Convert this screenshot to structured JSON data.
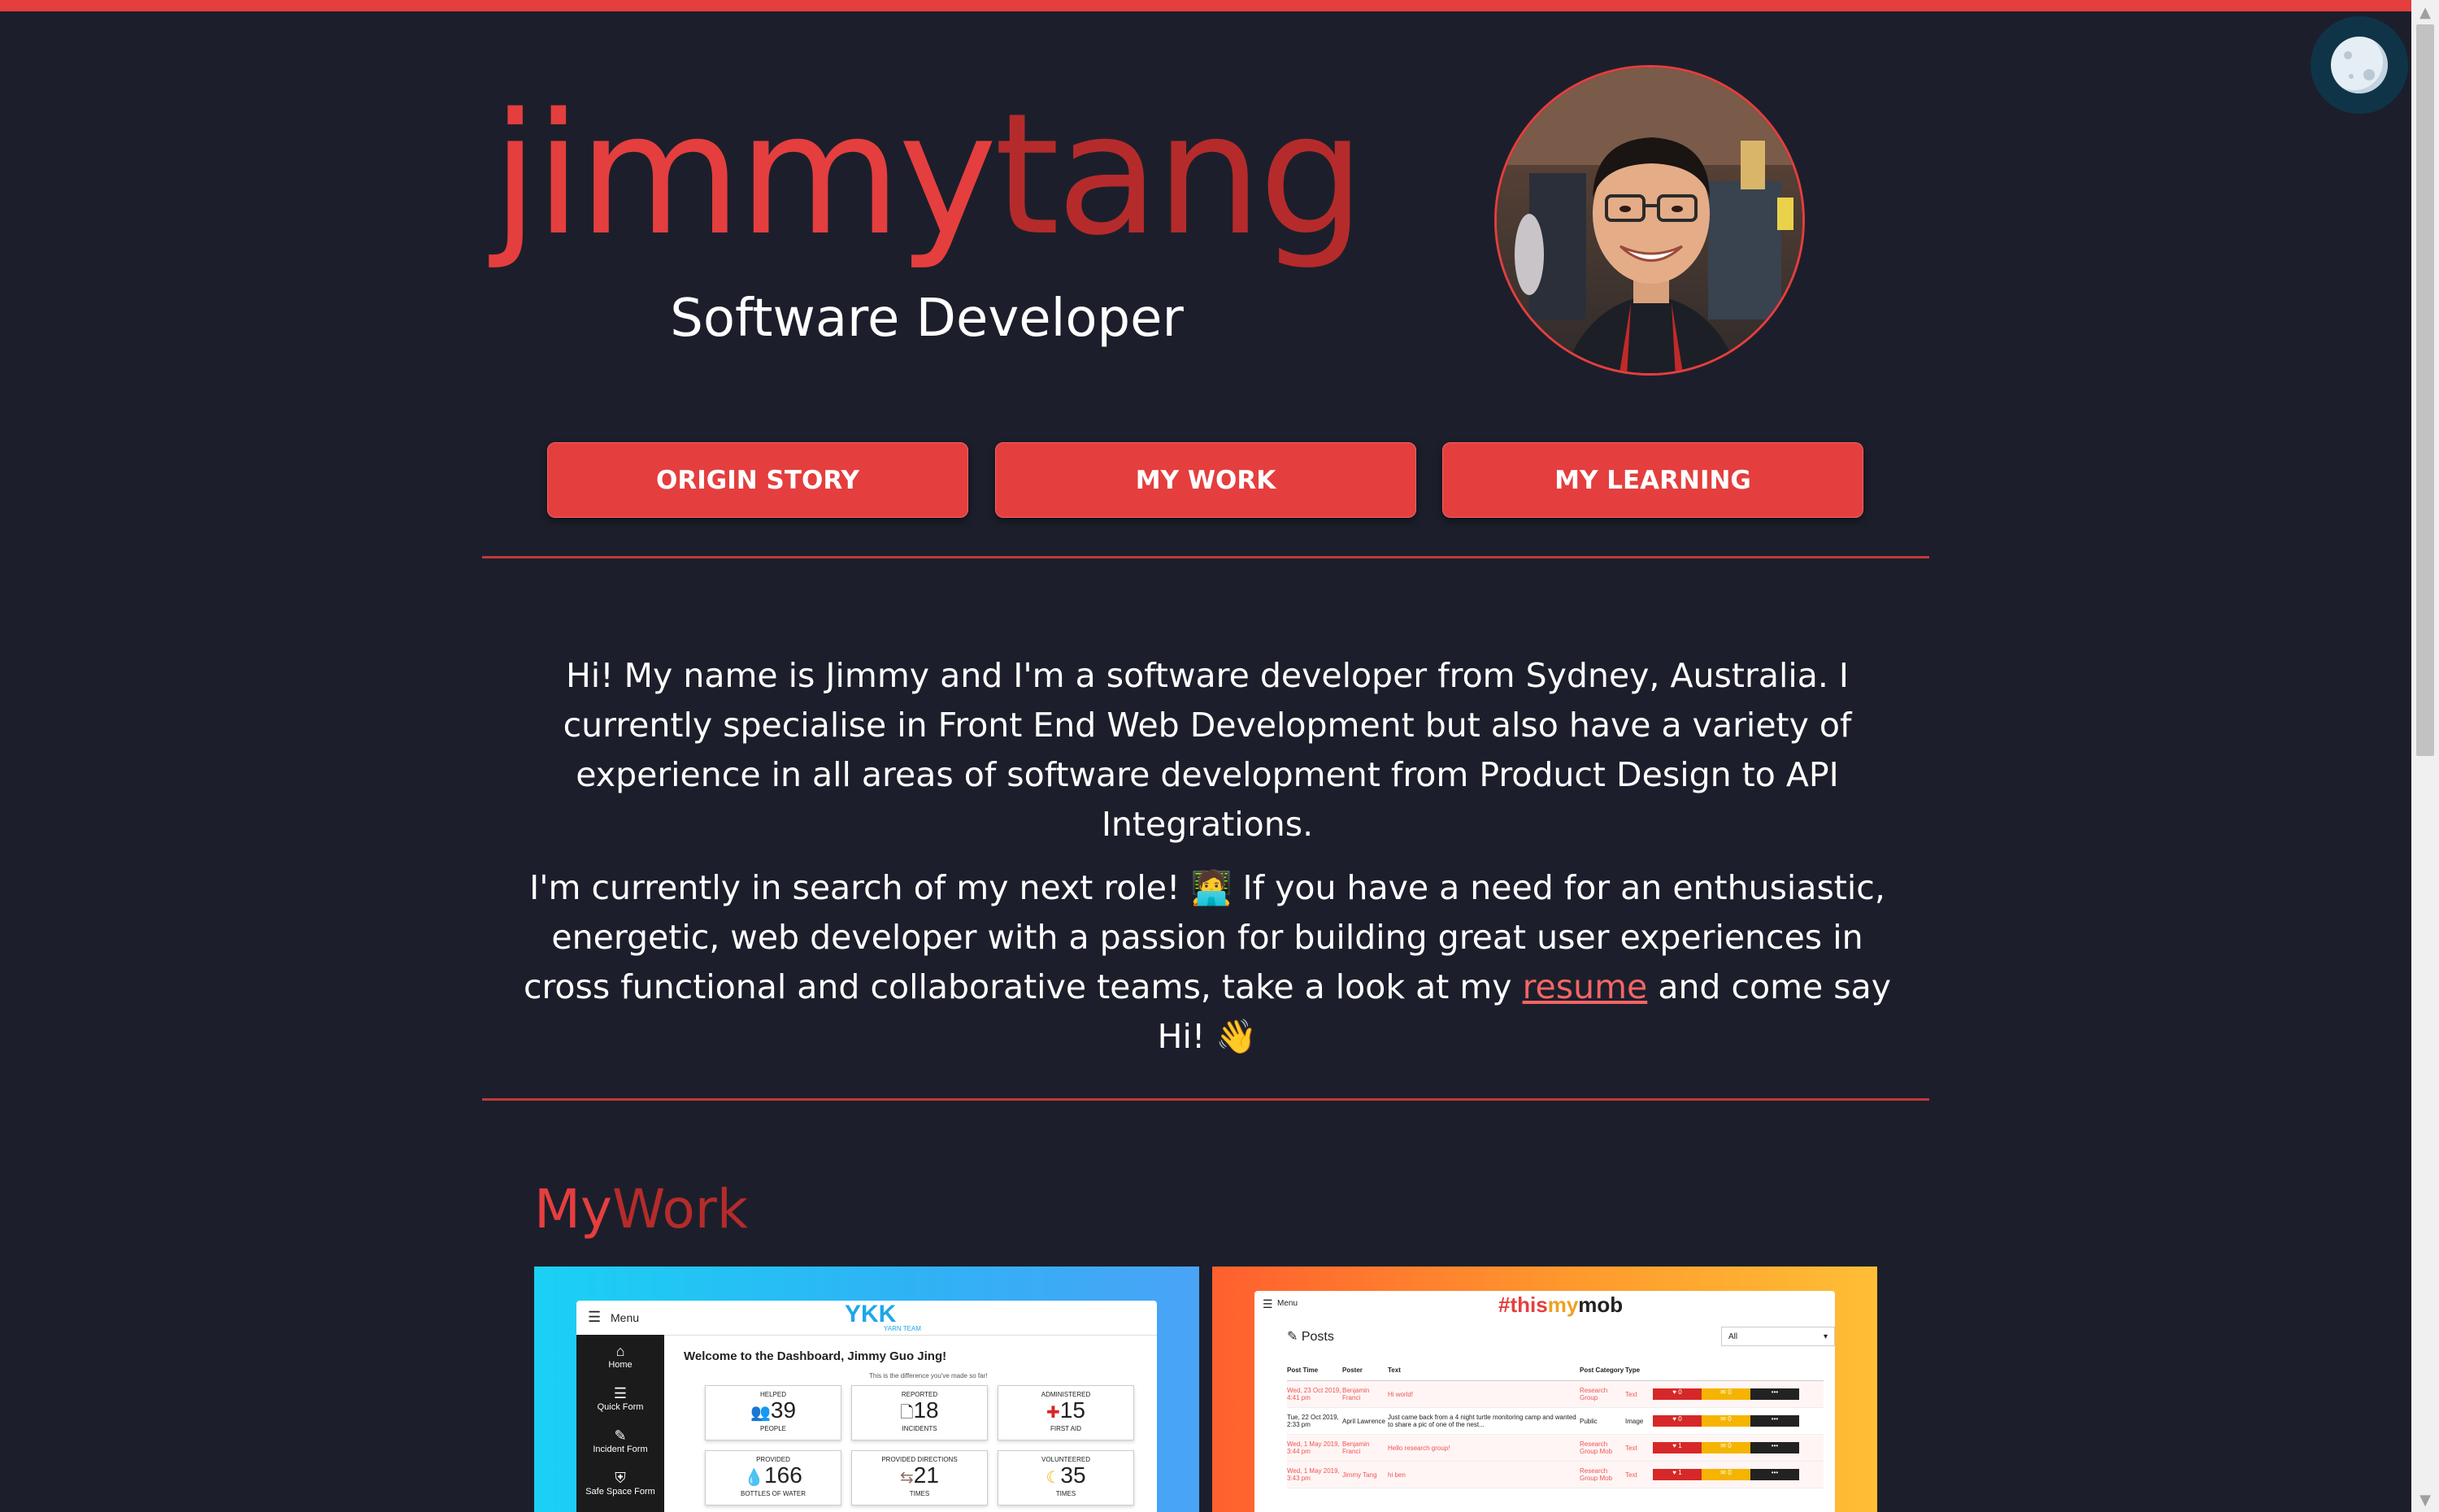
{
  "header": {
    "logo_first": "jimmy",
    "logo_last": "tang",
    "subtitle": "Software Developer"
  },
  "nav": {
    "origin_story": "ORIGIN STORY",
    "my_work": "MY WORK",
    "my_learning": "MY LEARNING"
  },
  "intro": {
    "p1": "Hi! My name is Jimmy and I'm a software developer from Sydney, Australia. I currently specialise in Front End Web Development but also have a variety of experience in all areas of software development from Product Design to API Integrations.",
    "p2_before": "I'm currently in search of my next role! 🧑‍💻 If you have a need for an enthusiastic, energetic, web developer with a passion for building great user experiences in cross functional and collaborative teams, take a look at my ",
    "p2_link": "resume",
    "p2_after": " and come say Hi! 👋"
  },
  "work": {
    "title_first": "My",
    "title_last": "Work",
    "card1": {
      "menu": "Menu",
      "brand": "YKK",
      "sub_brand": "YARN TEAM",
      "welcome": "Welcome to the Dashboard, Jimmy Guo Jing!",
      "tagline": "This is the difference you've made so far!",
      "sidebar": [
        "Home",
        "Quick Form",
        "Incident Form",
        "Safe Space Form"
      ],
      "stats": [
        {
          "top": "HELPED",
          "value": "39",
          "bottom": "PEOPLE"
        },
        {
          "top": "REPORTED",
          "value": "18",
          "bottom": "INCIDENTS"
        },
        {
          "top": "ADMINISTERED",
          "value": "15",
          "bottom": "FIRST AID"
        },
        {
          "top": "PROVIDED",
          "value": "166",
          "bottom": "BOTTLES OF WATER"
        },
        {
          "top": "PROVIDED DIRECTIONS",
          "value": "21",
          "bottom": "TIMES"
        },
        {
          "top": "VOLUNTEERED",
          "value": "35",
          "bottom": "TIMES"
        }
      ]
    },
    "card2": {
      "menu": "Menu",
      "logo_hash": "#",
      "logo_this": "this",
      "logo_my": "my",
      "logo_mob": "mob",
      "posts_title": "Posts",
      "filter": "All",
      "columns": [
        "Post Time",
        "Poster",
        "Text",
        "Post Category",
        "Type"
      ],
      "rows": [
        {
          "time": "Wed, 23 Oct 2019, 4:41 pm",
          "poster": "Benjamin Franci",
          "text": "Hi world!",
          "category": "Research Group",
          "type": "Text",
          "likes": "0",
          "comments": "0"
        },
        {
          "time": "Tue, 22 Oct 2019, 2:33 pm",
          "poster": "April Lawrence",
          "text": "Just came back from a 4 night turtle monitoring camp and wanted to share a pic of one of the nest...",
          "category": "Public",
          "type": "Image",
          "likes": "0",
          "comments": "0"
        },
        {
          "time": "Wed, 1 May 2019, 3:44 pm",
          "poster": "Benjamin Franci",
          "text": "Hello research group!",
          "category": "Research Group Mob",
          "type": "Text",
          "likes": "1",
          "comments": "0"
        },
        {
          "time": "Wed, 1 May 2019, 3:43 pm",
          "poster": "Jimmy Tang",
          "text": "hi ben",
          "category": "Research Group Mob",
          "type": "Text",
          "likes": "1",
          "comments": "0"
        }
      ]
    }
  },
  "colors": {
    "background": "#1c1f2b",
    "accent": "#e53e3e",
    "accent_dark": "#b52b2b"
  }
}
